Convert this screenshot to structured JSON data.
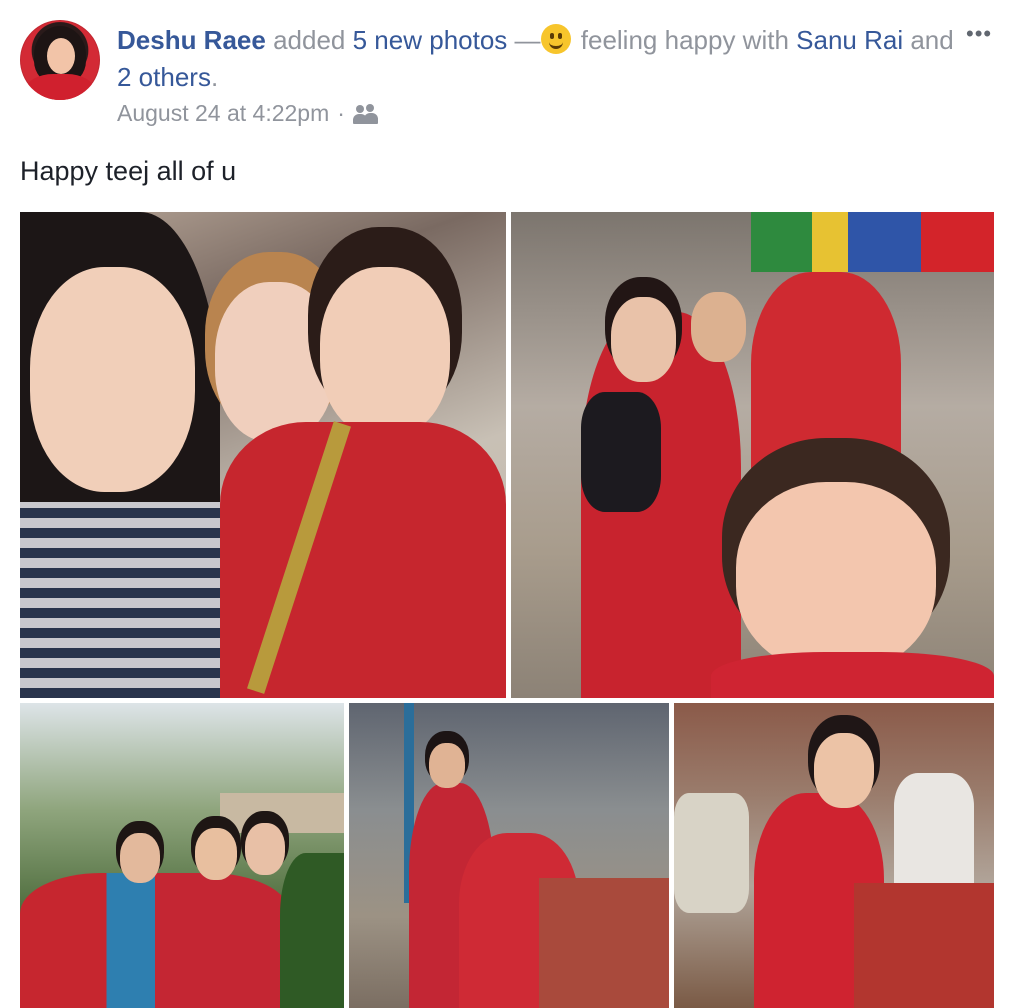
{
  "post": {
    "author": "Deshu Raee",
    "added": "added",
    "photos_link": "5 new photos",
    "dash": "—",
    "feeling": "feeling happy with",
    "tagged_person": "Sanu Rai",
    "and": "and",
    "others_link": "2 others",
    "period": ".",
    "timestamp": "August 24 at 4:22pm",
    "separator": "·",
    "audience_icon": "friends-icon",
    "more_icon": "•••",
    "caption": "Happy teej all of u"
  },
  "photos": [
    {
      "name": "photo-1",
      "icon": "photo"
    },
    {
      "name": "photo-2",
      "icon": "photo"
    },
    {
      "name": "photo-3",
      "icon": "photo"
    },
    {
      "name": "photo-4",
      "icon": "photo"
    },
    {
      "name": "photo-5",
      "icon": "photo"
    }
  ],
  "colors": {
    "link": "#365899",
    "meta": "#90949c",
    "text": "#1d2129"
  }
}
